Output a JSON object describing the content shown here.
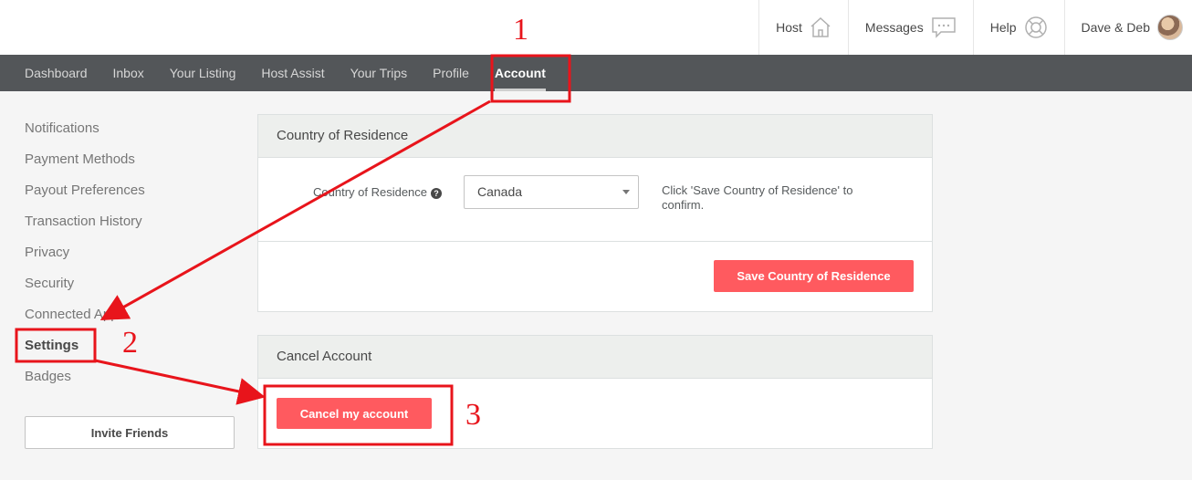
{
  "header": {
    "host_label": "Host",
    "messages_label": "Messages",
    "help_label": "Help",
    "user_name": "Dave & Deb"
  },
  "subnav": {
    "items": [
      "Dashboard",
      "Inbox",
      "Your Listing",
      "Host Assist",
      "Your Trips",
      "Profile",
      "Account"
    ],
    "active": "Account"
  },
  "sidebar": {
    "items": [
      "Notifications",
      "Payment Methods",
      "Payout Preferences",
      "Transaction History",
      "Privacy",
      "Security",
      "Connected Apps",
      "Settings",
      "Badges"
    ],
    "active": "Settings",
    "invite_label": "Invite Friends"
  },
  "country_panel": {
    "title": "Country of Residence",
    "field_label": "Country of Residence",
    "help_icon": "question-circle-icon",
    "selected_country": "Canada",
    "hint": "Click 'Save Country of Residence' to confirm.",
    "save_label": "Save Country of Residence"
  },
  "cancel_panel": {
    "title": "Cancel Account",
    "cancel_label": "Cancel my account"
  },
  "annotations": {
    "step1": "1",
    "step2": "2",
    "step3": "3",
    "color": "#e8141b"
  },
  "colors": {
    "brand_red": "#ff5a5f",
    "subnav_bg": "#535659"
  }
}
